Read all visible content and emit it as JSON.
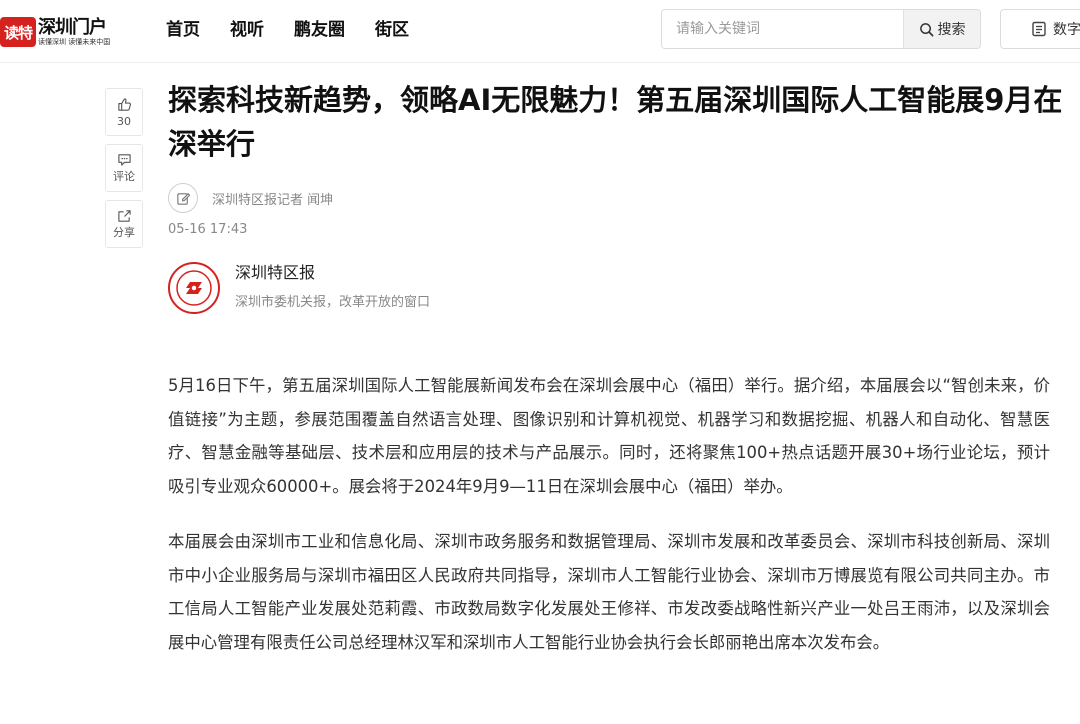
{
  "header": {
    "logo": {
      "badge": "读特",
      "main": "深圳门户",
      "sub": "读懂深圳 读懂未来中国"
    },
    "nav": [
      "首页",
      "视听",
      "鹏友圈",
      "街区"
    ],
    "search": {
      "placeholder": "请输入关键词",
      "button_label": "搜索"
    },
    "digital_label": "数字报"
  },
  "sidebar": {
    "like_count": "30",
    "comment_label": "评论",
    "share_label": "分享"
  },
  "article": {
    "title": "探索科技新趋势，领略AI无限魅力！第五届深圳国际人工智能展9月在深举行",
    "author": "深圳特区报记者 闻坤",
    "time": "05-16 17:43",
    "source_name": "深圳特区报",
    "source_desc": "深圳市委机关报，改革开放的窗口",
    "paragraphs": [
      "5月16日下午，第五届深圳国际人工智能展新闻发布会在深圳会展中心（福田）举行。据介绍，本届展会以“智创未来，价值链接”为主题，参展范围覆盖自然语言处理、图像识别和计算机视觉、机器学习和数据挖掘、机器人和自动化、智慧医疗、智慧金融等基础层、技术层和应用层的技术与产品展示。同时，还将聚焦100+热点话题开展30+场行业论坛，预计吸引专业观众60000+。展会将于2024年9月9—11日在深圳会展中心（福田）举办。",
      "本届展会由深圳市工业和信息化局、深圳市政务服务和数据管理局、深圳市发展和改革委员会、深圳市科技创新局、深圳市中小企业服务局与深圳市福田区人民政府共同指导，深圳市人工智能行业协会、深圳市万博展览有限公司共同主办。市工信局人工智能产业发展处范莉霞、市政数局数字化发展处王修祥、市发改委战略性新兴产业一处吕王雨沛，以及深圳会展中心管理有限责任公司总经理林汉军和深圳市人工智能行业协会执行会长郎丽艳出席本次发布会。"
    ]
  },
  "colors": {
    "brand_red": "#d6221f"
  }
}
